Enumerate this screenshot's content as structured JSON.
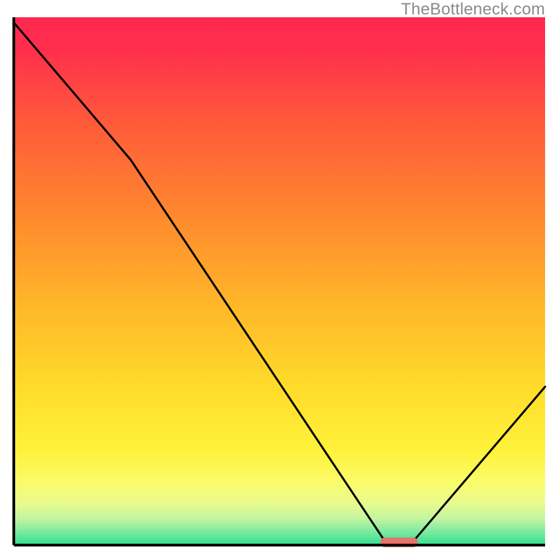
{
  "watermark": "TheBottleneck.com",
  "chart_data": {
    "type": "line",
    "title": "",
    "xlabel": "",
    "ylabel": "",
    "xlim": [
      0,
      100
    ],
    "ylim": [
      0,
      100
    ],
    "series": [
      {
        "name": "bottleneck-curve",
        "x": [
          0,
          22,
          70,
          75,
          100
        ],
        "y": [
          99,
          73,
          0.5,
          0.5,
          30
        ]
      }
    ],
    "marker": {
      "name": "optimal-region",
      "x_start": 69,
      "x_end": 76,
      "y": 0.5,
      "color": "#e8726d"
    },
    "background_gradient": {
      "stops": [
        {
          "offset": 0.0,
          "color": "#ff2850"
        },
        {
          "offset": 0.06,
          "color": "#ff2f4c"
        },
        {
          "offset": 0.2,
          "color": "#ff5a3a"
        },
        {
          "offset": 0.4,
          "color": "#ff8f2c"
        },
        {
          "offset": 0.55,
          "color": "#ffb829"
        },
        {
          "offset": 0.7,
          "color": "#ffdb2a"
        },
        {
          "offset": 0.82,
          "color": "#fff23a"
        },
        {
          "offset": 0.88,
          "color": "#fbfb6a"
        },
        {
          "offset": 0.92,
          "color": "#e9fb8e"
        },
        {
          "offset": 0.95,
          "color": "#c2f5a0"
        },
        {
          "offset": 0.975,
          "color": "#7ce9a1"
        },
        {
          "offset": 1.0,
          "color": "#2fe08e"
        }
      ]
    },
    "axis_stroke": "#000000",
    "axis_stroke_width": 4
  }
}
